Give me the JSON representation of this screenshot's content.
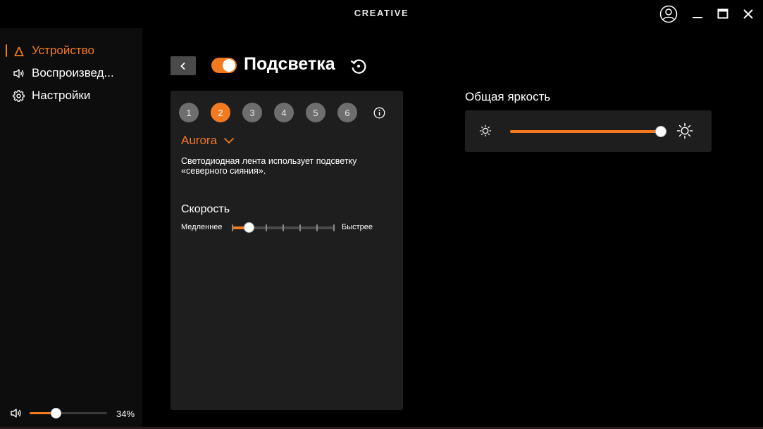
{
  "app": {
    "brand": "CREATIVE"
  },
  "titlebar": {
    "icons": [
      "account-icon",
      "minimize-icon",
      "maximize-icon",
      "close-icon"
    ]
  },
  "sidebar": {
    "items": [
      {
        "label": "Устройство",
        "icon": "device-icon",
        "active": true
      },
      {
        "label": "Воспроизвед...",
        "icon": "speaker-icon",
        "active": false
      },
      {
        "label": "Настройки",
        "icon": "gear-icon",
        "active": false
      }
    ],
    "volume": {
      "icon": "speaker-icon",
      "value": 34,
      "label": "34%"
    }
  },
  "header": {
    "title": "Подсветка",
    "toggle_on": true
  },
  "lighting": {
    "presets": [
      "1",
      "2",
      "3",
      "4",
      "5",
      "6"
    ],
    "selected_preset": "2",
    "effect": "Aurora",
    "description": "Светодиодная лента использует подсветку «северного сияния».",
    "speed": {
      "label": "Скорость",
      "min_label": "Медленнее",
      "max_label": "Быстрее",
      "steps": 7,
      "value_step": 1
    }
  },
  "brightness": {
    "label": "Общая яркость",
    "value": 100
  },
  "colors": {
    "accent": "#f47a1f",
    "background": "#000000",
    "panel": "#1e1e1e",
    "sidebar": "#0d0d0d"
  }
}
